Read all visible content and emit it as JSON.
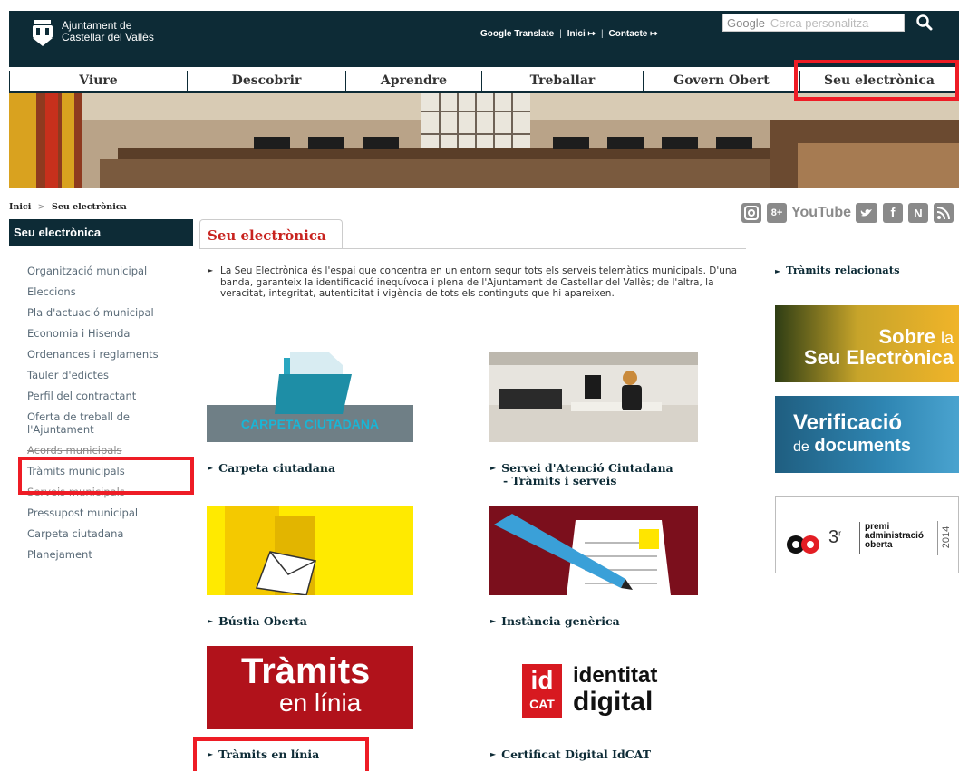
{
  "header": {
    "org_line1": "Ajuntament de",
    "org_line2": "Castellar del Vallès",
    "links": [
      "Google Translate",
      "Inici",
      "Contacte"
    ],
    "search_brand": "Google",
    "search_placeholder": "Cerca personalitza"
  },
  "nav": {
    "items": [
      "Viure",
      "Descobrir",
      "Aprendre",
      "Treballar",
      "Govern Obert",
      "Seu electrònica"
    ]
  },
  "breadcrumb": {
    "home": "Inici",
    "separator": ">",
    "current": "Seu electrònica"
  },
  "social": {
    "items": [
      {
        "icon": "instagram-icon"
      },
      {
        "icon": "googleplus-icon",
        "text": "8+"
      },
      {
        "icon": "youtube-icon",
        "text": "YouTube"
      },
      {
        "icon": "twitter-icon"
      },
      {
        "icon": "facebook-icon",
        "text": "f"
      },
      {
        "icon": "n-icon",
        "text": "N"
      },
      {
        "icon": "rss-icon"
      }
    ]
  },
  "sidebar": {
    "title": "Seu electrònica",
    "items": [
      "Organització municipal",
      "Eleccions",
      "Pla d'actuació municipal",
      "Economia i Hisenda",
      "Ordenances i reglaments",
      "Tauler d'edictes",
      "Perfil del contractant",
      "Oferta de treball de l'Ajuntament",
      "Acords municipals",
      "Tràmits municipals",
      "Serveis municipals",
      "Pressupost municipal",
      "Carpeta ciutadana",
      "Planejament"
    ]
  },
  "main": {
    "title": "Seu electrònica",
    "intro": "La Seu Electrònica és l'espai que concentra en un entorn segur tots els serveis telemàtics municipals. D'una banda, garanteix la identificació inequívoca i plena de l'Ajuntament de Castellar del Vallès; de l'altra, la veracitat, integritat, autenticitat i vigència de tots els continguts que hi apareixen.",
    "tiles": [
      {
        "label": "Carpeta ciutadana",
        "img_text": "CARPETA CIUTADANA"
      },
      {
        "label_line1": "Servei d'Atenció Ciutadana",
        "label_line2": "- Tràmits i serveis"
      },
      {
        "label": "Bústia Oberta"
      },
      {
        "label": "Instància genèrica"
      },
      {
        "label": "Tràmits en línia",
        "img_line1": "Tràmits",
        "img_line2": "en línia"
      },
      {
        "label": "Certificat Digital IdCAT",
        "img_id": "id",
        "img_cat": "CAT",
        "img_line1": "identitat",
        "img_line2": "digital"
      }
    ]
  },
  "right": {
    "related": "Tràmits relacionats",
    "banner1_line1": "Sobre",
    "banner1_la": "la",
    "banner1_line2": "Seu Electrònica",
    "banner2_line1": "Verificació",
    "banner2_de": "de",
    "banner2_line2": "documents",
    "banner3_num": "3",
    "banner3_sup": "r",
    "banner3_l1": "premi",
    "banner3_l2": "administració",
    "banner3_l3": "oberta",
    "banner3_year": "2014"
  },
  "colors": {
    "header_bg": "#0d2b36",
    "accent_red": "#c8231f",
    "highlight": "#ee1c25"
  }
}
